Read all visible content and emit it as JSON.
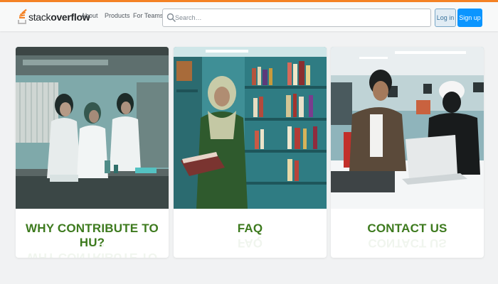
{
  "brand": {
    "name_part1": "stack",
    "name_part2": "overflow",
    "accent_color": "#f48225"
  },
  "nav": {
    "about": "About",
    "products": "Products",
    "for_teams": "For Teams"
  },
  "search": {
    "placeholder": "Search…",
    "icon": "search-icon"
  },
  "auth": {
    "login": "Log in",
    "signup": "Sign up"
  },
  "cards": [
    {
      "title": "WHY CONTRIBUTE TO HU?",
      "image": "students-in-laboratory"
    },
    {
      "title": "FAQ",
      "image": "student-reading-in-library"
    },
    {
      "title": "CONTACT US",
      "image": "students-with-laptop"
    }
  ],
  "colors": {
    "title_green": "#3d7a1e",
    "signup_blue": "#0a95ff",
    "login_bg": "#e1ecf4"
  }
}
